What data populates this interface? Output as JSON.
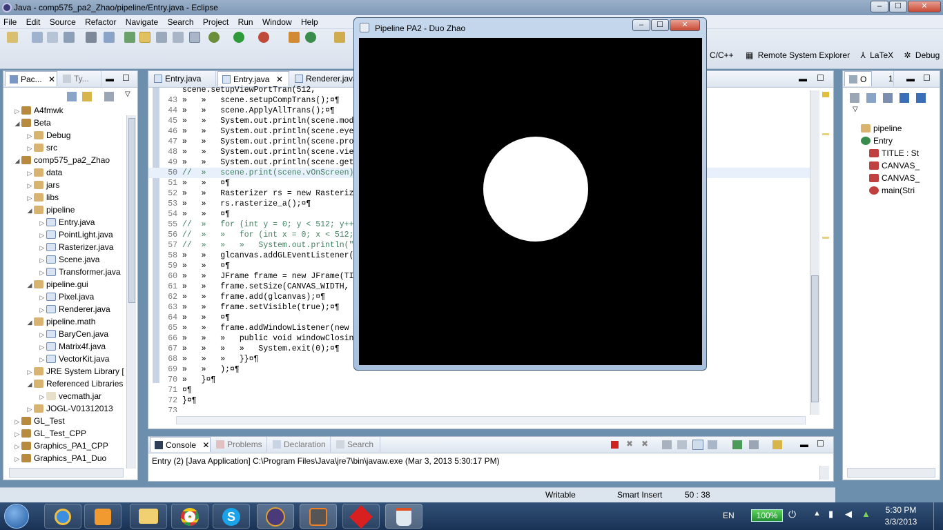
{
  "window": {
    "title": "Java - comp575_pa2_Zhao/pipeline/Entry.java - Eclipse",
    "min": "–",
    "max": "☐",
    "close": "✕"
  },
  "menu": [
    "File",
    "Edit",
    "Source",
    "Refactor",
    "Navigate",
    "Search",
    "Project",
    "Run",
    "Window",
    "Help"
  ],
  "perspectives": [
    "C/C++",
    "Remote System Explorer",
    "LaTeX",
    "Debug"
  ],
  "package_explorer": {
    "tabs": [
      "Pac...",
      "Ty..."
    ],
    "items": [
      {
        "label": "A4fmwk",
        "indent": 0,
        "arrow": "▷"
      },
      {
        "label": "Beta",
        "indent": 0,
        "arrow": "◢"
      },
      {
        "label": "Debug",
        "indent": 1,
        "arrow": "▷"
      },
      {
        "label": "src",
        "indent": 1,
        "arrow": "▷"
      },
      {
        "label": "comp575_pa2_Zhao",
        "indent": 0,
        "arrow": "◢"
      },
      {
        "label": "data",
        "indent": 1,
        "arrow": "▷"
      },
      {
        "label": "jars",
        "indent": 1,
        "arrow": "▷"
      },
      {
        "label": "libs",
        "indent": 1,
        "arrow": "▷"
      },
      {
        "label": "pipeline",
        "indent": 1,
        "arrow": "◢"
      },
      {
        "label": "Entry.java",
        "indent": 2,
        "arrow": "▷"
      },
      {
        "label": "PointLight.java",
        "indent": 2,
        "arrow": "▷"
      },
      {
        "label": "Rasterizer.java",
        "indent": 2,
        "arrow": "▷"
      },
      {
        "label": "Scene.java",
        "indent": 2,
        "arrow": "▷"
      },
      {
        "label": "Transformer.java",
        "indent": 2,
        "arrow": "▷"
      },
      {
        "label": "pipeline.gui",
        "indent": 1,
        "arrow": "◢"
      },
      {
        "label": "Pixel.java",
        "indent": 2,
        "arrow": "▷"
      },
      {
        "label": "Renderer.java",
        "indent": 2,
        "arrow": "▷"
      },
      {
        "label": "pipeline.math",
        "indent": 1,
        "arrow": "◢"
      },
      {
        "label": "BaryCen.java",
        "indent": 2,
        "arrow": "▷"
      },
      {
        "label": "Matrix4f.java",
        "indent": 2,
        "arrow": "▷"
      },
      {
        "label": "VectorKit.java",
        "indent": 2,
        "arrow": "▷"
      },
      {
        "label": "JRE System Library [",
        "indent": 1,
        "arrow": "▷"
      },
      {
        "label": "Referenced Libraries",
        "indent": 1,
        "arrow": "◢"
      },
      {
        "label": "vecmath.jar",
        "indent": 2,
        "arrow": "▷"
      },
      {
        "label": "JOGL-V01312013",
        "indent": 1,
        "arrow": "▷"
      },
      {
        "label": "GL_Test",
        "indent": 0,
        "arrow": "▷"
      },
      {
        "label": "GL_Test_CPP",
        "indent": 0,
        "arrow": "▷"
      },
      {
        "label": "Graphics_PA1_CPP",
        "indent": 0,
        "arrow": "▷"
      },
      {
        "label": "Graphics_PA1_Duo",
        "indent": 0,
        "arrow": "▷"
      }
    ]
  },
  "editor": {
    "tabs": [
      "Entry.java",
      "Entry.java",
      "Renderer.java"
    ],
    "lines": [
      {
        "n": "",
        "code": "scene.setupViewPortTran(512,"
      },
      {
        "n": "43",
        "code": "»   »   scene.setupCompTrans();¤¶"
      },
      {
        "n": "44",
        "code": "»   »   scene.ApplyAllTrans();¤¶"
      },
      {
        "n": "45",
        "code": "»   »   System.out.println(scene.mode"
      },
      {
        "n": "46",
        "code": "»   »   System.out.println(scene.eyeT"
      },
      {
        "n": "47",
        "code": "»   »   System.out.println(scene.proj"
      },
      {
        "n": "48",
        "code": "»   »   System.out.println(scene.view"
      },
      {
        "n": "49",
        "code": "»   »   System.out.println(scene.getC"
      },
      {
        "n": "50",
        "code": "//  »   scene.print(scene.vOnScreen)"
      },
      {
        "n": "51",
        "code": "»   »   ¤¶"
      },
      {
        "n": "52",
        "code": "»   »   Rasterizer rs = new Rasterize"
      },
      {
        "n": "53",
        "code": "»   »   rs.rasterize_a();¤¶"
      },
      {
        "n": "54",
        "code": "»   »   ¤¶"
      },
      {
        "n": "55",
        "code": "//  »   for (int y = 0; y < 512; y++"
      },
      {
        "n": "56",
        "code": "//  »   »   for (int x = 0; x < 512;"
      },
      {
        "n": "57",
        "code": "//  »   »   »   System.out.println(\""
      },
      {
        "n": "58",
        "code": "»   »   glcanvas.addGLEventListener(n"
      },
      {
        "n": "59",
        "code": "»   »   ¤¶"
      },
      {
        "n": "60",
        "code": "»   »   JFrame frame = new JFrame(TIT"
      },
      {
        "n": "61",
        "code": "»   »   frame.setSize(CANVAS_WIDTH, C"
      },
      {
        "n": "62",
        "code": "»   »   frame.add(glcanvas);¤¶"
      },
      {
        "n": "63",
        "code": "»   »   frame.setVisible(true);¤¶"
      },
      {
        "n": "64",
        "code": "»   »   ¤¶"
      },
      {
        "n": "65",
        "code": "»   »   frame.addWindowListener(new W"
      },
      {
        "n": "66",
        "code": "»   »   »   public void windowClosing"
      },
      {
        "n": "67",
        "code": "»   »   »   »   System.exit(0);¤¶"
      },
      {
        "n": "68",
        "code": "»   »   »   }}¤¶"
      },
      {
        "n": "69",
        "code": "»   »   );¤¶"
      },
      {
        "n": "70",
        "code": "»   }¤¶"
      },
      {
        "n": "71",
        "code": "¤¶"
      },
      {
        "n": "72",
        "code": "}¤¶"
      },
      {
        "n": "73",
        "code": ""
      }
    ]
  },
  "outline": {
    "tabs": [
      "O",
      "1"
    ],
    "items": [
      {
        "label": "pipeline",
        "indent": 1
      },
      {
        "label": "Entry",
        "indent": 1
      },
      {
        "label": "TITLE : St",
        "indent": 2
      },
      {
        "label": "CANVAS_",
        "indent": 2
      },
      {
        "label": "CANVAS_",
        "indent": 2
      },
      {
        "label": "main(Stri",
        "indent": 2
      }
    ]
  },
  "console": {
    "tabs": [
      "Console",
      "Problems",
      "Declaration",
      "Search"
    ],
    "text": "Entry (2) [Java Application] C:\\Program Files\\Java\\jre7\\bin\\javaw.exe (Mar 3, 2013 5:30:17 PM)"
  },
  "status": {
    "writable": "Writable",
    "insert": "Smart Insert",
    "position": "50 : 38"
  },
  "java_window": {
    "title": "Pipeline PA2 - Duo Zhao",
    "min": "–",
    "max": "☐",
    "close": "✕"
  },
  "taskbar": {
    "lang": "EN",
    "battery": "100%",
    "time": "5:30 PM",
    "date": "3/3/2013"
  }
}
